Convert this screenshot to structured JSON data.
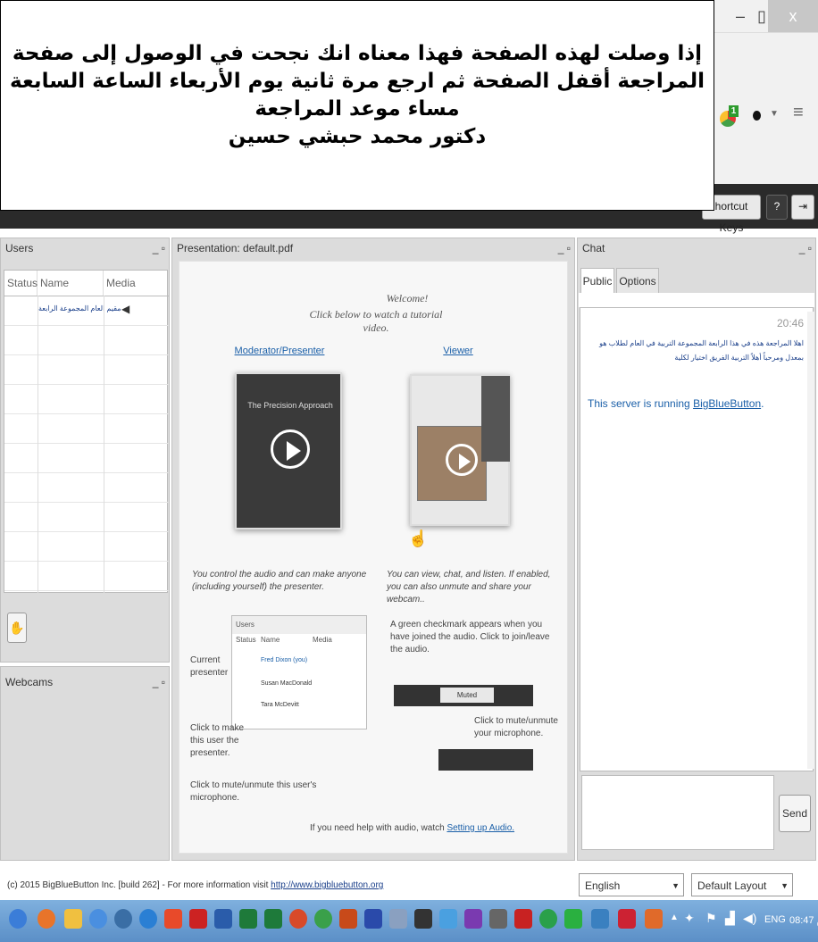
{
  "window_controls": {
    "minimize": "–",
    "restore": "▯",
    "close": "x"
  },
  "extension": {
    "badge": "1"
  },
  "notice": {
    "lines": [
      "إذا وصلت لهذه الصفحة فهذا معناه انك نجحت في الوصول إلى صفحة",
      "المراجعة أقفل الصفحة ثم ارجع مرة ثانية يوم الأربعاء الساعة السابعة",
      "مساء موعد المراجعة",
      "دكتور محمد حبشي حسين"
    ]
  },
  "topbar": {
    "shortcut_label": "hortcut Keys",
    "help_label": "?"
  },
  "users_panel": {
    "title": "Users",
    "columns": [
      "Status",
      "Name",
      "Media"
    ],
    "rows": [
      {
        "name": "مقيم العام المجموعة الرابعة"
      }
    ]
  },
  "webcams_panel": {
    "title": "Webcams"
  },
  "presentation": {
    "title": "Presentation: default.pdf",
    "welcome": "Welcome!",
    "welcome_sub": "Click below to watch a tutorial video.",
    "moderator_heading": "Moderator/Presenter",
    "viewer_heading": "Viewer",
    "video_title": "The Precision Approach",
    "moderator_desc": "You control the audio and can make anyone (including yourself) the presenter.",
    "viewer_desc": "You can view, chat, and listen. If enabled, you can also unmute and share your webcam..",
    "mini_users": {
      "title": "Users",
      "columns": [
        "Status",
        "Name",
        "Media"
      ],
      "rows": [
        "Fred Dixon (you)",
        "Susan MacDonald",
        "Tara McDevitt"
      ]
    },
    "current_presenter": "Current presenter",
    "click_make": "Click to make this user the presenter.",
    "click_mute": "Click to mute/unmute this user's microphone.",
    "green_check": "A green checkmark appears when you have joined the audio. Click to join/leave the audio.",
    "muted_label": "Muted",
    "mute_unmute": "Click to mute/unmute your microphone.",
    "help_prefix": "If you need help with audio, watch",
    "help_link": "Setting up Audio."
  },
  "chat_panel": {
    "title": "Chat",
    "tabs": [
      "Public",
      "Options"
    ],
    "time": "20:46",
    "welcome_message": "اهلا المراجعة هذه في هذا الرابعة المجموعة التربية في العام لطلاب هو بمعدل ومرحباً أهلاً التربية الفريق اختيار لكلية",
    "server_prefix": "This server is running",
    "server_link": "BigBlueButton",
    "server_suffix": ".",
    "send_label": "Send"
  },
  "footer": {
    "copyright": "(c) 2015 BigBlueButton Inc. [build 262] - For more information visit",
    "link": "http://www.bigbluebutton.org",
    "language": "English",
    "layout": "Default Layout"
  },
  "taskbar": {
    "lang": "ENG",
    "clock": "08:47 م"
  }
}
